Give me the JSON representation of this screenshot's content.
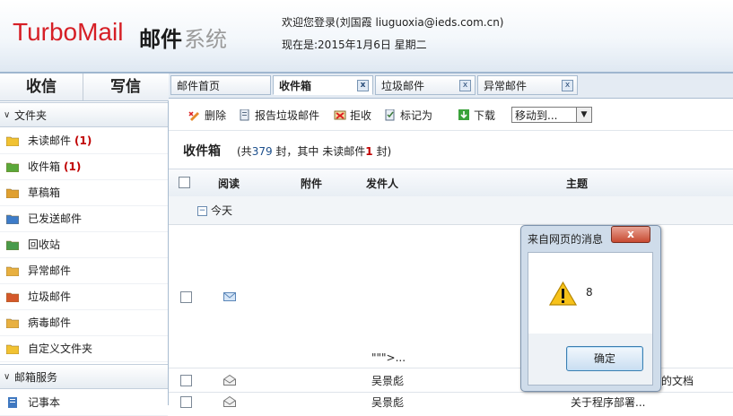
{
  "header": {
    "logo_turbo": "TurboMail",
    "logo_mail": "邮件",
    "logo_sys": "系统",
    "welcome": "欢迎您登录(刘国霞  liuguoxia@ieds.com.cn)",
    "today": "现在是:2015年1月6日  星期二"
  },
  "nav": {
    "inbox": "收信",
    "compose": "写信"
  },
  "tabs": [
    {
      "label": "邮件首页"
    },
    {
      "label": "收件箱",
      "close": "x"
    },
    {
      "label": "垃圾邮件",
      "close": "x"
    },
    {
      "label": "异常邮件",
      "close": "x"
    }
  ],
  "sidebar": {
    "folders_heading": "文件夹",
    "folders": [
      {
        "label": "未读邮件",
        "count": "(1)",
        "icon": "unread-folder-icon"
      },
      {
        "label": "收件箱",
        "count": "(1)",
        "icon": "inbox-folder-icon"
      },
      {
        "label": "草稿箱",
        "count": "",
        "icon": "drafts-folder-icon"
      },
      {
        "label": "已发送邮件",
        "count": "",
        "icon": "sent-folder-icon"
      },
      {
        "label": "回收站",
        "count": "",
        "icon": "recycle-folder-icon"
      },
      {
        "label": "异常邮件",
        "count": "",
        "icon": "abnormal-folder-icon"
      },
      {
        "label": "垃圾邮件",
        "count": "",
        "icon": "spam-folder-icon"
      },
      {
        "label": "病毒邮件",
        "count": "",
        "icon": "virus-folder-icon"
      },
      {
        "label": "自定义文件夹",
        "count": "",
        "icon": "custom-folder-icon"
      }
    ],
    "services_heading": "邮箱服务",
    "services": [
      {
        "label": "记事本"
      }
    ]
  },
  "toolbar": {
    "delete": "删除",
    "report_spam": "报告垃圾邮件",
    "reject": "拒收",
    "mark_as": "标记为",
    "download": "下载",
    "move_to": "移动到..."
  },
  "folder": {
    "title": "收件箱",
    "summary_prefix": "(共",
    "total": "379",
    "summary_mid": "封，其中 未读邮件",
    "unread": "1",
    "summary_suffix": "封)"
  },
  "table": {
    "headers": {
      "read": "阅读",
      "attach": "附件",
      "sender": "发件人",
      "subject": "主题"
    },
    "group": "今天",
    "rows": [
      {
        "sender": "\"\"\">...",
        "subject": ""
      },
      {
        "sender": "吴景彪",
        "subject": "的文档"
      },
      {
        "sender": "吴景彪",
        "subject": "关于程序部署..."
      }
    ]
  },
  "dialog": {
    "title": "来自网页的消息",
    "close": "x",
    "message": "8",
    "ok": "确定"
  },
  "colors": {
    "brand_red": "#d61f26",
    "count_red": "#c00000",
    "accent_blue": "#1c4f8c"
  }
}
